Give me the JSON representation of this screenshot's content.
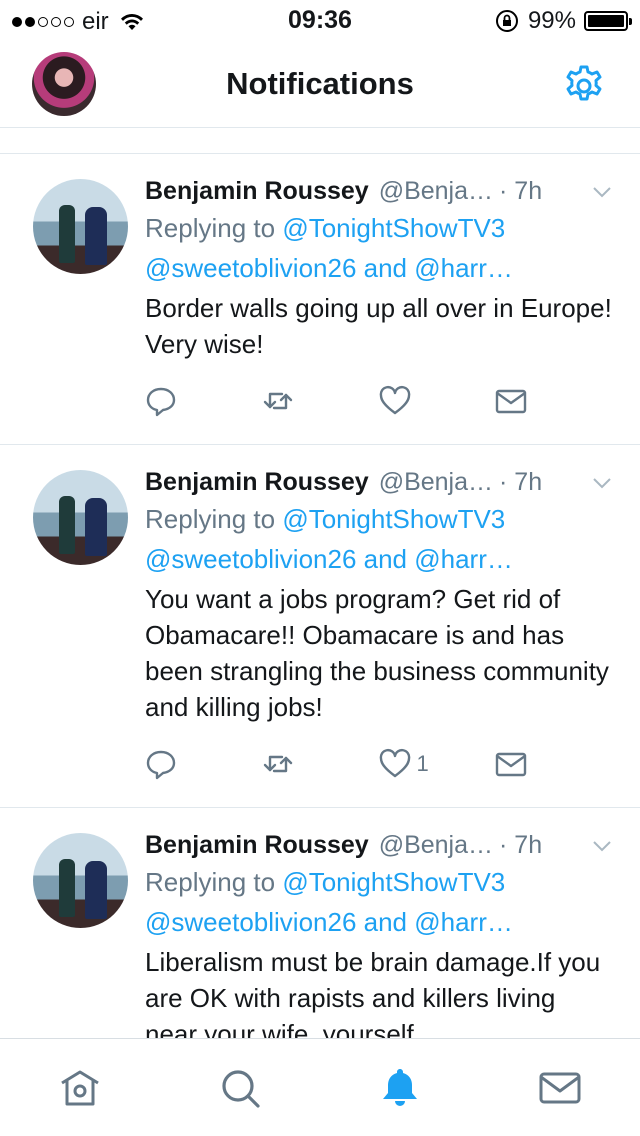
{
  "status_bar": {
    "carrier": "eir",
    "time": "09:36",
    "battery_percent": "99%",
    "signal_bars_filled": 2,
    "signal_bars_total": 5
  },
  "header": {
    "title": "Notifications"
  },
  "tweets": [
    {
      "name": "Benjamin Roussey",
      "handle": "@Benja…",
      "time": "· 7h",
      "reply_prefix": "Replying to ",
      "reply_mention": "@TonightShowTV3",
      "reply_line2": "@sweetoblivion26 and @harr…",
      "text": "Border walls going up all over in Europe! Very wise!",
      "like_count": ""
    },
    {
      "name": "Benjamin Roussey",
      "handle": "@Benja…",
      "time": "· 7h",
      "reply_prefix": "Replying to ",
      "reply_mention": "@TonightShowTV3",
      "reply_line2": "@sweetoblivion26 and @harr…",
      "text": "You want a jobs program? Get rid of Obamacare!! Obamacare is and has been strangling the business community and killing jobs!",
      "like_count": "1"
    },
    {
      "name": "Benjamin Roussey",
      "handle": "@Benja…",
      "time": "· 7h",
      "reply_prefix": "Replying to ",
      "reply_mention": "@TonightShowTV3",
      "reply_line2": "@sweetoblivion26 and @harr…",
      "text": "Liberalism must be brain damage.If you are OK with rapists and killers living near your wife, yourself,",
      "like_count": ""
    }
  ],
  "colors": {
    "accent": "#1da1f2",
    "secondary_text": "#657786",
    "primary_text": "#14171a",
    "divider": "#e1e8ed"
  },
  "icons": {
    "tabs": [
      "home-icon",
      "search-icon",
      "notifications-bell-icon",
      "messages-envelope-icon"
    ],
    "actions": [
      "reply-icon",
      "retweet-icon",
      "like-heart-icon",
      "direct-message-icon"
    ]
  }
}
